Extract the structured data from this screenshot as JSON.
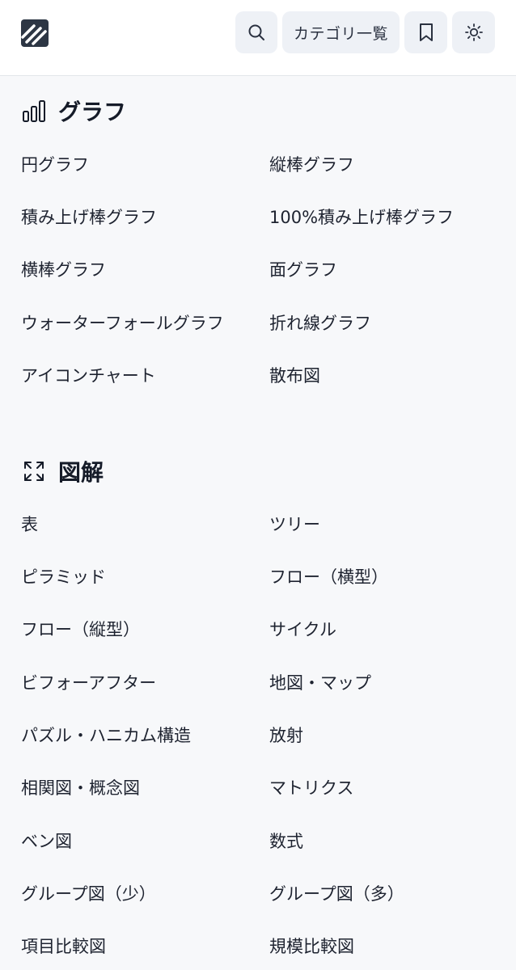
{
  "header": {
    "logo_icon": "logo-icon",
    "search_icon": "search-icon",
    "category_label": "カテゴリ一覧",
    "bookmark_icon": "bookmark-icon",
    "theme_icon": "sun-icon"
  },
  "sections": [
    {
      "title": "グラフ",
      "icon": "bar-chart-icon",
      "items": [
        "円グラフ",
        "縦棒グラフ",
        "積み上げ棒グラフ",
        "100%積み上げ棒グラフ",
        "横棒グラフ",
        "面グラフ",
        "ウォーターフォールグラフ",
        "折れ線グラフ",
        "アイコンチャート",
        "散布図"
      ]
    },
    {
      "title": "図解",
      "icon": "expand-icon",
      "items": [
        "表",
        "ツリー",
        "ピラミッド",
        "フロー（横型）",
        "フロー（縦型）",
        "サイクル",
        "ビフォーアフター",
        "地図・マップ",
        "パズル・ハニカム構造",
        "放射",
        "相関図・概念図",
        "マトリクス",
        "ベン図",
        "数式",
        "グループ図（少）",
        "グループ図（多）",
        "項目比較図",
        "規模比較図"
      ]
    }
  ]
}
